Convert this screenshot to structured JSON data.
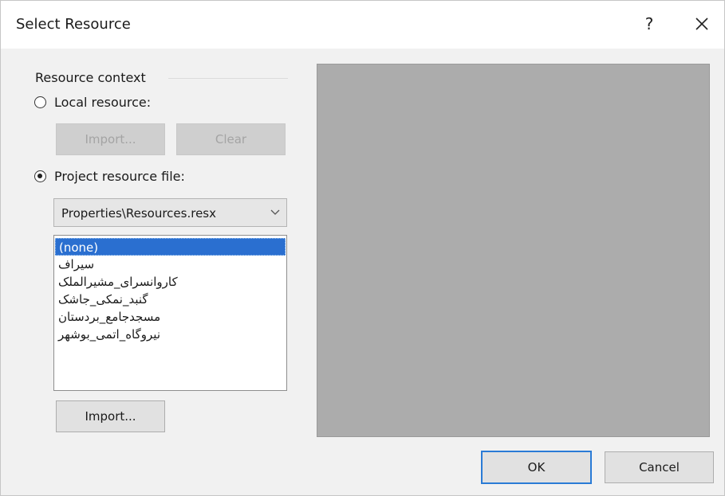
{
  "window": {
    "title": "Select Resource",
    "help_label": "?",
    "close_icon": "close-icon"
  },
  "resource_context": {
    "label": "Resource context",
    "local_resource": {
      "label": "Local resource:",
      "selected": false,
      "import_label": "Import...",
      "clear_label": "Clear",
      "buttons_enabled": false
    },
    "project_resource": {
      "label": "Project resource file:",
      "selected": true,
      "file_select": {
        "value": "Properties\\Resources.resx",
        "arrow_icon": "chevron-down-icon"
      },
      "items": [
        {
          "label": "(none)",
          "selected": true
        },
        {
          "label": "سیراف",
          "selected": false
        },
        {
          "label": "کاروانسرای_مشیرالملک",
          "selected": false
        },
        {
          "label": "گنبد_نمکی_جاشک",
          "selected": false
        },
        {
          "label": "مسجدجامع_بردستان",
          "selected": false
        },
        {
          "label": "نیروگاه_اتمی_بوشهر",
          "selected": false
        }
      ],
      "import_label": "Import..."
    }
  },
  "footer": {
    "ok_label": "OK",
    "cancel_label": "Cancel"
  },
  "colors": {
    "selection": "#2a6fd0",
    "preview_background": "#acacac",
    "default_button_border": "#2a7bd6"
  }
}
